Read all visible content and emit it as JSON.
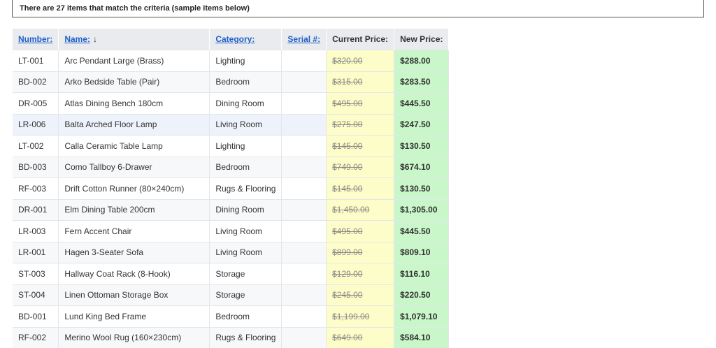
{
  "notice": "There are 27 items that match the criteria (sample items below)",
  "columns": {
    "number": "Number:",
    "name": "Name:",
    "name_sort_arrow": "↓",
    "category": "Category:",
    "serial": "Serial #:",
    "current_price": "Current Price:",
    "new_price": "New Price:"
  },
  "rows": [
    {
      "number": "LT-001",
      "name": "Arc Pendant Large (Brass)",
      "category": "Lighting",
      "serial": "",
      "current": "$320.00",
      "new": "$288.00"
    },
    {
      "number": "BD-002",
      "name": "Arko Bedside Table (Pair)",
      "category": "Bedroom",
      "serial": "",
      "current": "$315.00",
      "new": "$283.50"
    },
    {
      "number": "DR-005",
      "name": "Atlas Dining Bench 180cm",
      "category": "Dining Room",
      "serial": "",
      "current": "$495.00",
      "new": "$445.50"
    },
    {
      "number": "LR-006",
      "name": "Balta Arched Floor Lamp",
      "category": "Living Room",
      "serial": "",
      "current": "$275.00",
      "new": "$247.50"
    },
    {
      "number": "LT-002",
      "name": "Calla Ceramic Table Lamp",
      "category": "Lighting",
      "serial": "",
      "current": "$145.00",
      "new": "$130.50"
    },
    {
      "number": "BD-003",
      "name": "Como Tallboy 6-Drawer",
      "category": "Bedroom",
      "serial": "",
      "current": "$749.00",
      "new": "$674.10"
    },
    {
      "number": "RF-003",
      "name": "Drift Cotton Runner (80×240cm)",
      "category": "Rugs & Flooring",
      "serial": "",
      "current": "$145.00",
      "new": "$130.50"
    },
    {
      "number": "DR-001",
      "name": "Elm Dining Table 200cm",
      "category": "Dining Room",
      "serial": "",
      "current": "$1,450.00",
      "new": "$1,305.00"
    },
    {
      "number": "LR-003",
      "name": "Fern Accent Chair",
      "category": "Living Room",
      "serial": "",
      "current": "$495.00",
      "new": "$445.50"
    },
    {
      "number": "LR-001",
      "name": "Hagen 3-Seater Sofa",
      "category": "Living Room",
      "serial": "",
      "current": "$899.00",
      "new": "$809.10"
    },
    {
      "number": "ST-003",
      "name": "Hallway Coat Rack (8-Hook)",
      "category": "Storage",
      "serial": "",
      "current": "$129.00",
      "new": "$116.10"
    },
    {
      "number": "ST-004",
      "name": "Linen Ottoman Storage Box",
      "category": "Storage",
      "serial": "",
      "current": "$245.00",
      "new": "$220.50"
    },
    {
      "number": "BD-001",
      "name": "Lund King Bed Frame",
      "category": "Bedroom",
      "serial": "",
      "current": "$1,199.00",
      "new": "$1,079.10"
    },
    {
      "number": "RF-002",
      "name": "Merino Wool Rug (160×230cm)",
      "category": "Rugs & Flooring",
      "serial": "",
      "current": "$649.00",
      "new": "$584.10"
    }
  ],
  "colors": {
    "link": "#1f5fc8",
    "current_price_bg": "#fdfdc9",
    "new_price_bg": "#c9f7c9",
    "header_bg": "#e9ebef",
    "hover_row_bg": "#edf2fb"
  }
}
